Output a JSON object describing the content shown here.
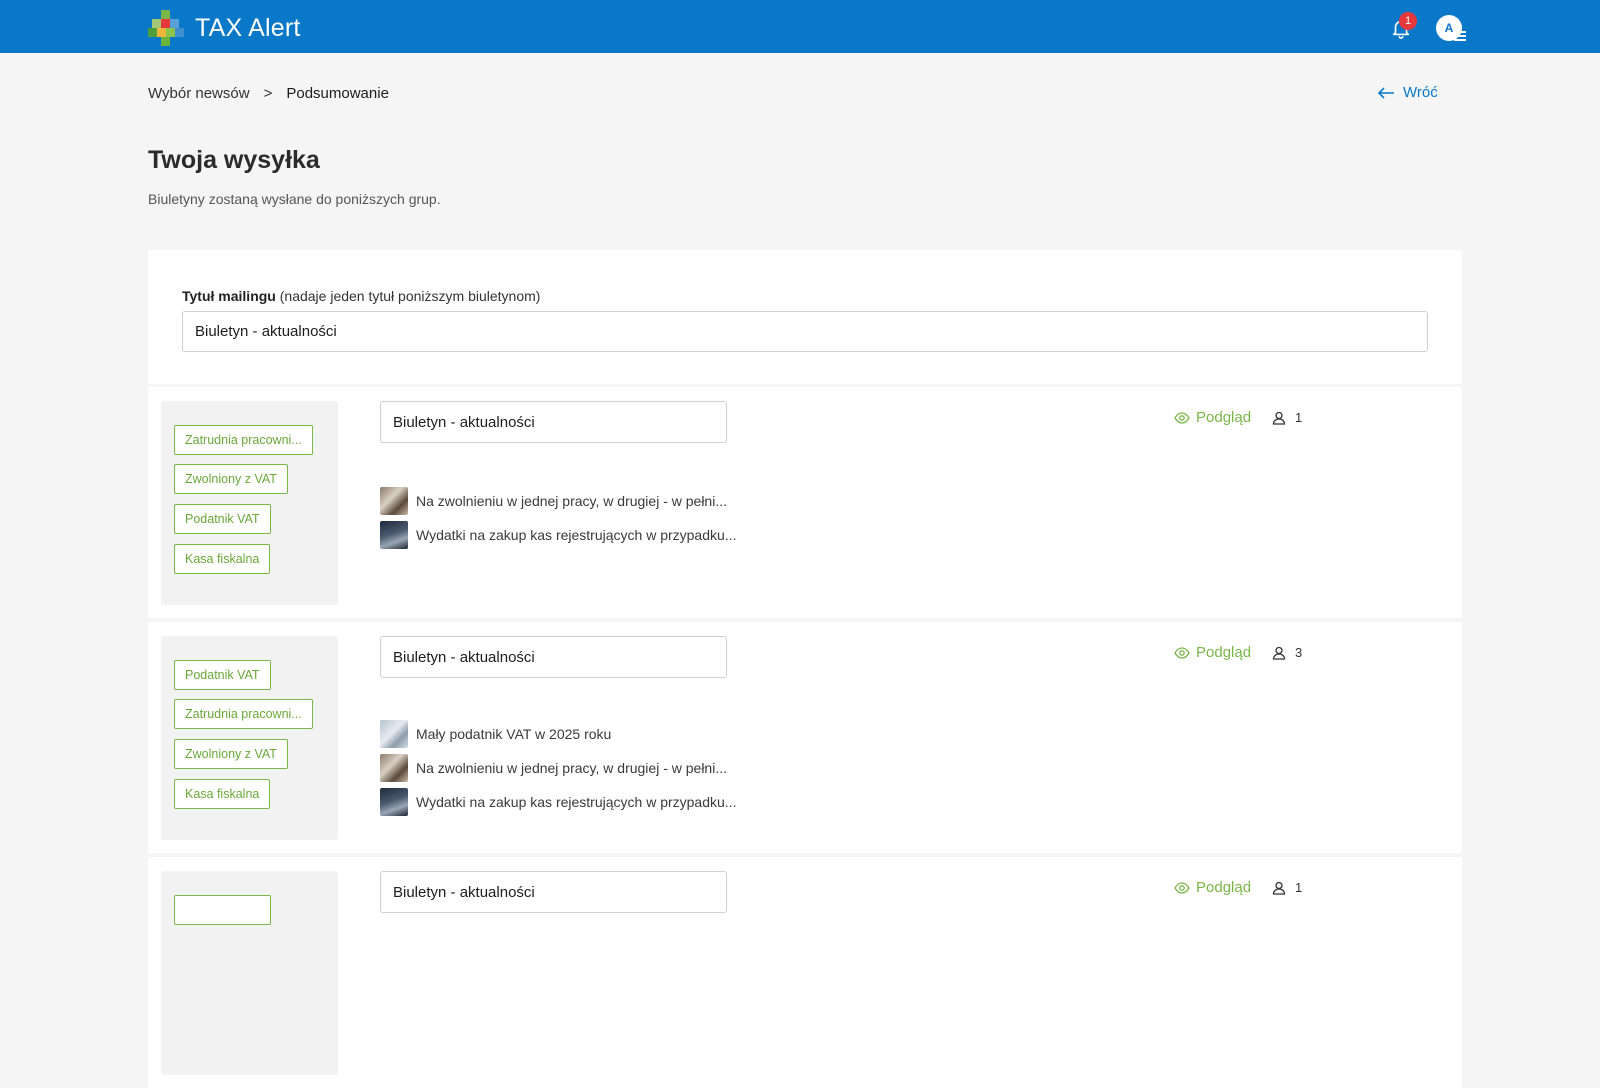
{
  "app": {
    "title": "TAX Alert",
    "notifications_count": "1",
    "avatar_initials": "A"
  },
  "breadcrumb": {
    "items": [
      "Wybór newsów",
      "Podsumowanie"
    ],
    "separator": ">"
  },
  "back_label": "Wróć",
  "page": {
    "title": "Twoja wysyłka",
    "subtitle": "Biuletyny zostaną wysłane do poniższych grup."
  },
  "mailing": {
    "label": "Tytuł mailingu",
    "hint": "(nadaje jeden tytuł poniższym biuletynom)",
    "value": "Biuletyn - aktualności"
  },
  "groups": [
    {
      "tags": [
        "Zatrudnia pracowni...",
        "Zwolniony z VAT",
        "Podatnik VAT",
        "Kasa fiskalna"
      ],
      "title": "Biuletyn - aktualności",
      "preview_label": "Podgląd",
      "recipients": "1",
      "news": [
        "Na zwolnieniu w jednej pracy, w drugiej - w pełni...",
        "Wydatki na zakup kas rejestrujących w przypadku..."
      ]
    },
    {
      "tags": [
        "Podatnik VAT",
        "Zatrudnia pracowni...",
        "Zwolniony z VAT",
        "Kasa fiskalna"
      ],
      "title": "Biuletyn - aktualności",
      "preview_label": "Podgląd",
      "recipients": "3",
      "news": [
        "Mały podatnik VAT w 2025 roku",
        "Na zwolnieniu w jednej pracy, w drugiej - w pełni...",
        "Wydatki na zakup kas rejestrujących w przypadku..."
      ]
    },
    {
      "tags": [],
      "title": "Biuletyn - aktualności",
      "preview_label": "Podgląd",
      "recipients": "1",
      "news": []
    }
  ],
  "colors": {
    "header": "#0a78c8",
    "accent_green": "#7ab648",
    "badge": "#e5383d",
    "link_blue": "#0a78c8"
  }
}
